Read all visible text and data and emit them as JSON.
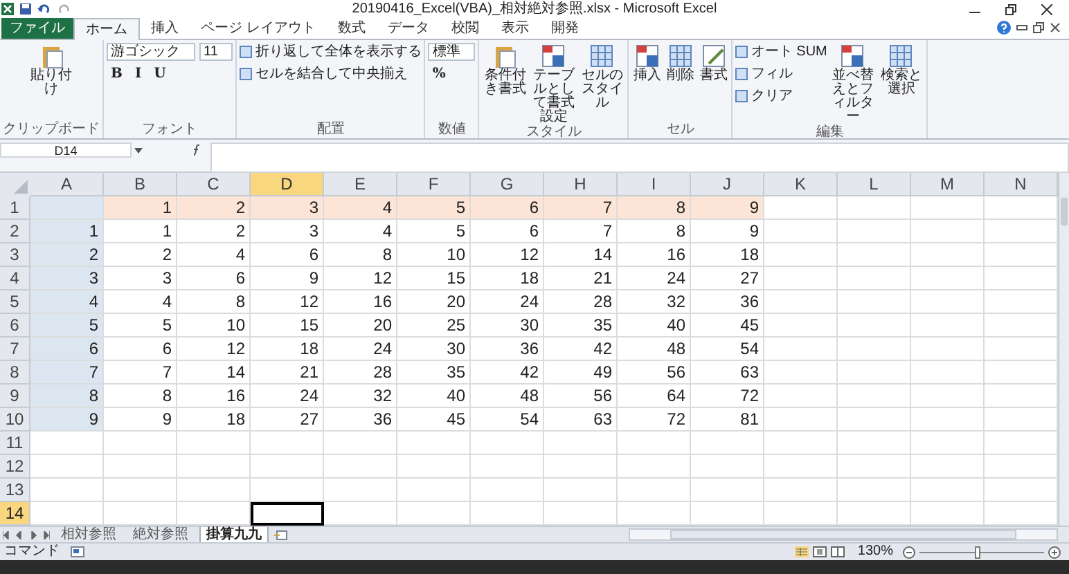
{
  "title": "20190416_Excel(VBA)_相対絶対参照.xlsx - Microsoft Excel",
  "tabs": [
    {
      "label": "ファイル",
      "kind": "file",
      "selected": false
    },
    {
      "label": "ホーム",
      "kind": "tab",
      "selected": true
    },
    {
      "label": "挿入",
      "kind": "tab",
      "selected": false
    },
    {
      "label": "ページ レイアウト",
      "kind": "tab",
      "selected": false
    },
    {
      "label": "数式",
      "kind": "tab",
      "selected": false
    },
    {
      "label": "データ",
      "kind": "tab",
      "selected": false
    },
    {
      "label": "校閲",
      "kind": "tab",
      "selected": false
    },
    {
      "label": "表示",
      "kind": "tab",
      "selected": false
    },
    {
      "label": "開発",
      "kind": "tab",
      "selected": false
    }
  ],
  "ribbon": {
    "groups": [
      {
        "label": "クリップボード",
        "items": [
          {
            "kind": "large",
            "label": "貼り付け"
          }
        ]
      },
      {
        "label": "フォント",
        "items": [
          {
            "kind": "select",
            "value": "游ゴシック"
          },
          {
            "kind": "select",
            "value": "11"
          },
          {
            "kind": "glyph",
            "label": "B"
          },
          {
            "kind": "glyph",
            "label": "I"
          },
          {
            "kind": "glyph",
            "label": "U"
          }
        ]
      },
      {
        "label": "配置",
        "items": [
          {
            "kind": "small",
            "label": "折り返して全体を表示する"
          },
          {
            "kind": "small",
            "label": "セルを結合して中央揃え"
          }
        ]
      },
      {
        "label": "数値",
        "items": [
          {
            "kind": "select",
            "value": "標準"
          },
          {
            "kind": "glyph",
            "label": "%"
          }
        ]
      },
      {
        "label": "スタイル",
        "items": [
          {
            "kind": "large",
            "label": "条件付き書式"
          },
          {
            "kind": "large",
            "label": "テーブルとして書式設定"
          },
          {
            "kind": "large",
            "label": "セルのスタイル"
          }
        ]
      },
      {
        "label": "セル",
        "items": [
          {
            "kind": "large",
            "label": "挿入"
          },
          {
            "kind": "large",
            "label": "削除"
          },
          {
            "kind": "large",
            "label": "書式"
          }
        ]
      },
      {
        "label": "編集",
        "items": [
          {
            "kind": "small",
            "label": "オート SUM"
          },
          {
            "kind": "small",
            "label": "フィル"
          },
          {
            "kind": "small",
            "label": "クリア"
          },
          {
            "kind": "large",
            "label": "並べ替えとフィルター"
          },
          {
            "kind": "large",
            "label": "検索と選択"
          }
        ]
      }
    ]
  },
  "name_box": "D14",
  "columns": [
    {
      "label": "A",
      "selected": false
    },
    {
      "label": "B",
      "selected": false
    },
    {
      "label": "C",
      "selected": false
    },
    {
      "label": "D",
      "selected": true
    },
    {
      "label": "E",
      "selected": false
    },
    {
      "label": "F",
      "selected": false
    },
    {
      "label": "G",
      "selected": false
    },
    {
      "label": "H",
      "selected": false
    },
    {
      "label": "I",
      "selected": false
    },
    {
      "label": "J",
      "selected": false
    },
    {
      "label": "K",
      "selected": false
    },
    {
      "label": "L",
      "selected": false
    },
    {
      "label": "M",
      "selected": false
    },
    {
      "label": "N",
      "selected": false
    }
  ],
  "rows": [
    {
      "header": "1",
      "selected": false,
      "values": [
        "1",
        "2",
        "3",
        "4",
        "5",
        "6",
        "7",
        "8",
        "9"
      ]
    },
    {
      "header": "2",
      "selected": false,
      "label": "1",
      "values": [
        "1",
        "2",
        "3",
        "4",
        "5",
        "6",
        "7",
        "8",
        "9"
      ]
    },
    {
      "header": "3",
      "selected": false,
      "label": "2",
      "values": [
        "2",
        "4",
        "6",
        "8",
        "10",
        "12",
        "14",
        "16",
        "18"
      ]
    },
    {
      "header": "4",
      "selected": false,
      "label": "3",
      "values": [
        "3",
        "6",
        "9",
        "12",
        "15",
        "18",
        "21",
        "24",
        "27"
      ]
    },
    {
      "header": "5",
      "selected": false,
      "label": "4",
      "values": [
        "4",
        "8",
        "12",
        "16",
        "20",
        "24",
        "28",
        "32",
        "36"
      ]
    },
    {
      "header": "6",
      "selected": false,
      "label": "5",
      "values": [
        "5",
        "10",
        "15",
        "20",
        "25",
        "30",
        "35",
        "40",
        "45"
      ]
    },
    {
      "header": "7",
      "selected": false,
      "label": "6",
      "values": [
        "6",
        "12",
        "18",
        "24",
        "30",
        "36",
        "42",
        "48",
        "54"
      ]
    },
    {
      "header": "8",
      "selected": false,
      "label": "7",
      "values": [
        "7",
        "14",
        "21",
        "28",
        "35",
        "42",
        "49",
        "56",
        "63"
      ]
    },
    {
      "header": "9",
      "selected": false,
      "label": "8",
      "values": [
        "8",
        "16",
        "24",
        "32",
        "40",
        "48",
        "56",
        "64",
        "72"
      ]
    },
    {
      "header": "10",
      "selected": false,
      "label": "9",
      "values": [
        "9",
        "18",
        "27",
        "36",
        "45",
        "54",
        "63",
        "72",
        "81"
      ]
    },
    {
      "header": "11",
      "selected": false
    },
    {
      "header": "12",
      "selected": false
    },
    {
      "header": "13",
      "selected": false
    },
    {
      "header": "14",
      "selected": true
    }
  ],
  "sheet_tabs": [
    {
      "label": "相対参照",
      "selected": false
    },
    {
      "label": "絶対参照",
      "selected": false
    },
    {
      "label": "掛算九九",
      "selected": true
    }
  ],
  "status_bar": {
    "mode": "コマンド",
    "zoom": "130%",
    "zoom_slider": {
      "level": 0.47
    }
  }
}
